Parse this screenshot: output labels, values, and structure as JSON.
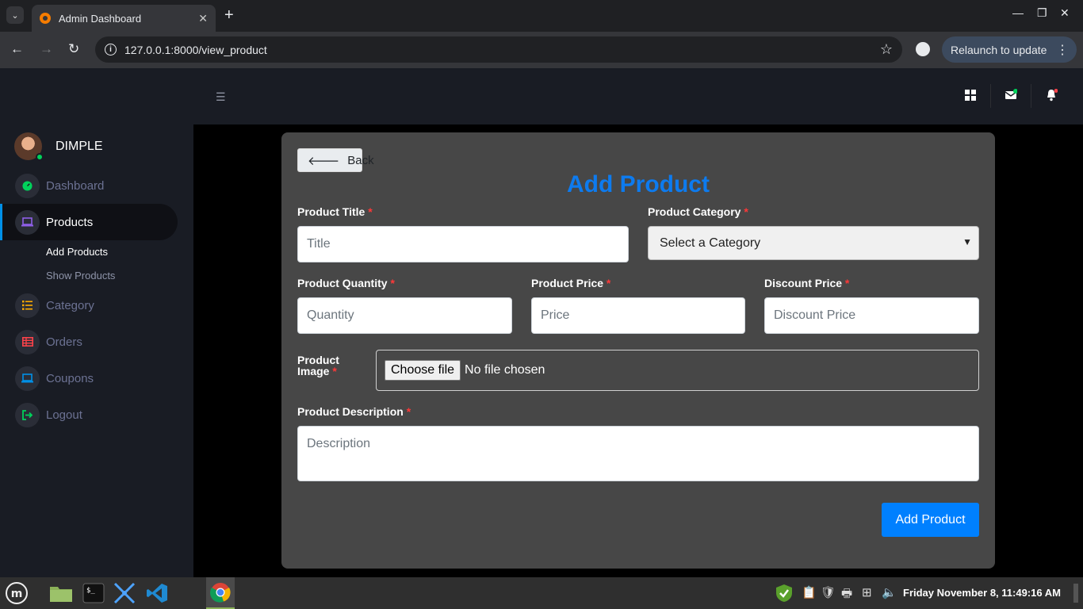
{
  "browser": {
    "tab_title": "Admin Dashboard",
    "url": "127.0.0.1:8000/view_product",
    "relaunch_label": "Relaunch to update"
  },
  "sidebar": {
    "username": "DIMPLE",
    "items": [
      {
        "label": "Dashboard",
        "icon": "speedometer-icon",
        "color": "#00d25b"
      },
      {
        "label": "Products",
        "icon": "laptop-icon",
        "color": "#8f5fe8"
      },
      {
        "label": "Category",
        "icon": "list-icon",
        "color": "#ffab00"
      },
      {
        "label": "Orders",
        "icon": "table-icon",
        "color": "#fc424a"
      },
      {
        "label": "Coupons",
        "icon": "laptop-icon",
        "color": "#0090e7"
      },
      {
        "label": "Logout",
        "icon": "logout-icon",
        "color": "#00d25b"
      }
    ],
    "submenu": [
      "Add Products",
      "Show Products"
    ]
  },
  "form": {
    "back_label": "Back",
    "title": "Add Product",
    "required_mark": "*",
    "product_title_label": "Product Title",
    "product_title_placeholder": "Title",
    "category_label": "Product Category",
    "category_selected": "Select a Category",
    "quantity_label": "Product Quantity",
    "quantity_placeholder": "Quantity",
    "price_label": "Product Price",
    "price_placeholder": "Price",
    "discount_label": "Discount Price",
    "discount_placeholder": "Discount Price",
    "image_label_line1": "Product",
    "image_label_line2": "Image",
    "choose_file_label": "Choose file",
    "file_status": "No file chosen",
    "description_label": "Product Description",
    "description_placeholder": "Description",
    "submit_label": "Add Product"
  },
  "taskbar": {
    "clock": "Friday November  8, 11:49:16 AM"
  }
}
